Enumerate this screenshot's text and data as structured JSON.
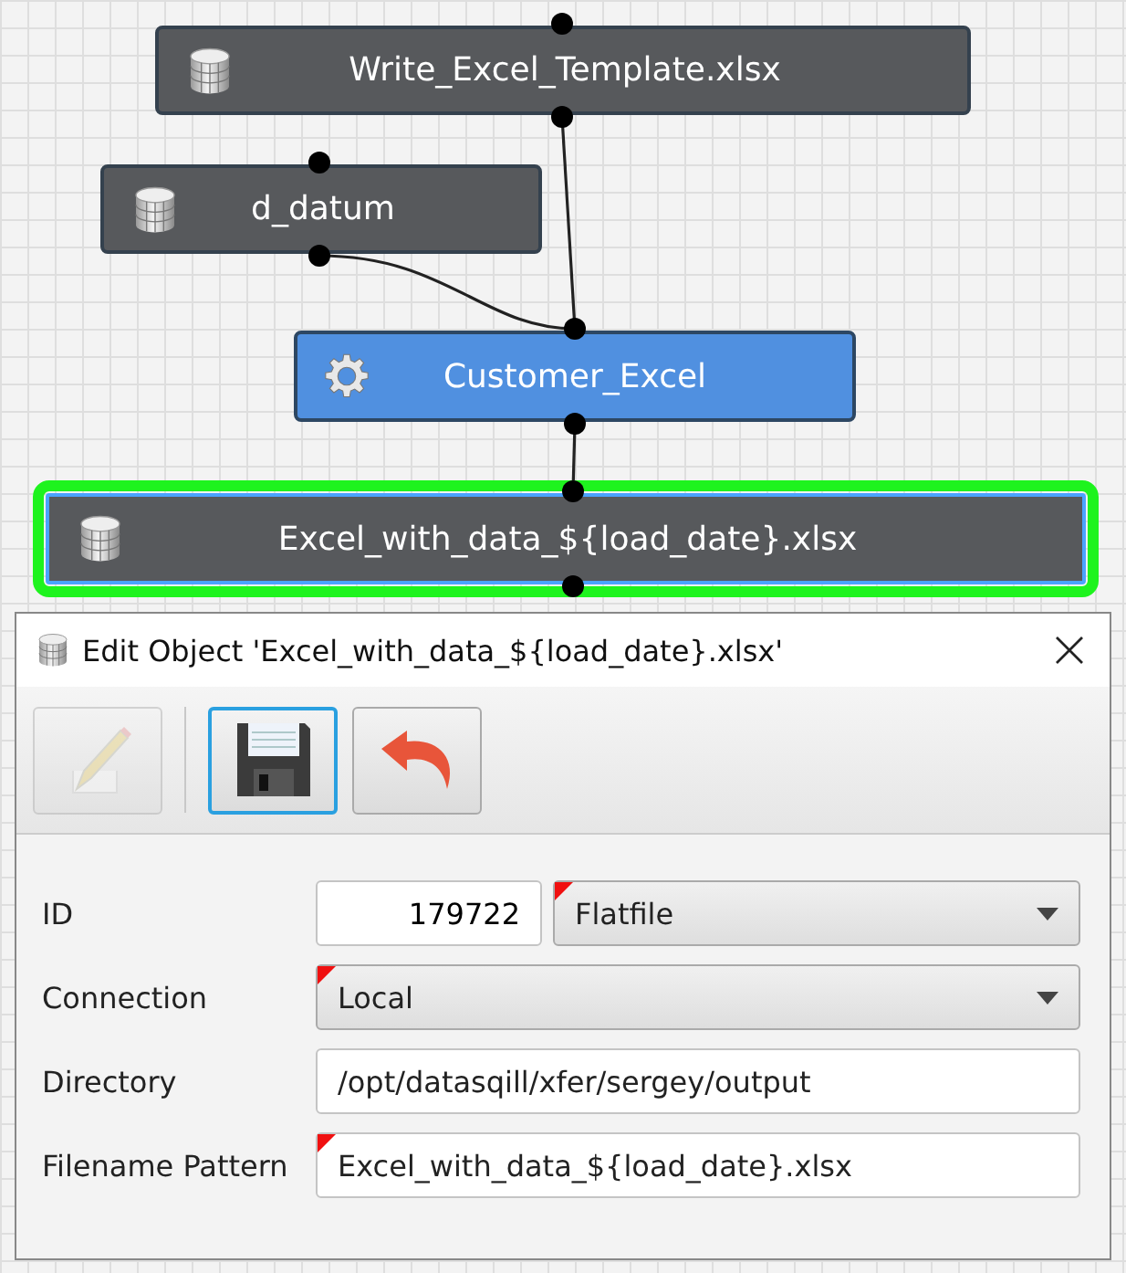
{
  "nodes": [
    {
      "kind": "database",
      "label": "Write_Excel_Template.xlsx",
      "selected": false
    },
    {
      "kind": "database",
      "label": "d_datum",
      "selected": false
    },
    {
      "kind": "transform",
      "label": "Customer_Excel",
      "selected": false
    },
    {
      "kind": "database",
      "label": "Excel_with_data_${load_date}.xlsx",
      "selected": true
    }
  ],
  "dialog": {
    "title": "Edit Object 'Excel_with_data_${load_date}.xlsx'",
    "toolbar": [
      {
        "kind": "edit",
        "disabled": true,
        "focused": false
      },
      {
        "kind": "save",
        "disabled": false,
        "focused": true
      },
      {
        "kind": "undo",
        "disabled": false,
        "focused": false
      }
    ],
    "fields": [
      {
        "label": "ID",
        "parts": [
          {
            "kind": "number",
            "value": "179722",
            "flagged": false
          },
          {
            "kind": "select",
            "value": "Flatfile",
            "flagged": true
          }
        ]
      },
      {
        "label": "Connection",
        "parts": [
          {
            "kind": "select",
            "value": "Local",
            "flagged": true
          }
        ]
      },
      {
        "label": "Directory",
        "parts": [
          {
            "kind": "text",
            "value": "/opt/datasqill/xfer/sergey/output",
            "flagged": false
          }
        ]
      },
      {
        "label": "Filename Pattern",
        "parts": [
          {
            "kind": "text",
            "value": "Excel_with_data_${load_date}.xlsx",
            "flagged": true
          }
        ]
      }
    ]
  }
}
